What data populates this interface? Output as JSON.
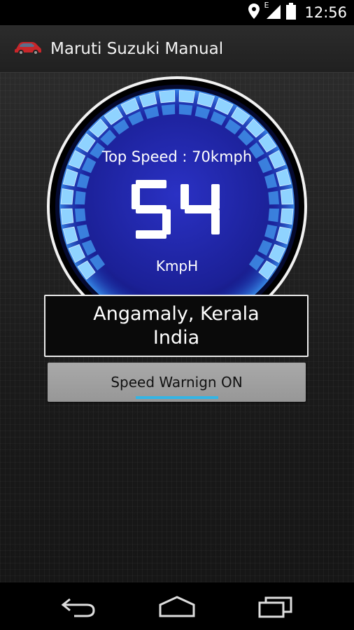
{
  "status_bar": {
    "time": "12:56",
    "network_type": "E",
    "icons": [
      "location-icon",
      "signal-icon",
      "battery-icon"
    ]
  },
  "action_bar": {
    "title": "Maruti Suzuki Manual",
    "icon": "car-icon"
  },
  "speedometer": {
    "top_speed_label": "Top Speed : 70kmph",
    "speed": "54",
    "unit": "KmpH",
    "colors": {
      "face": "#1a1f9e",
      "segments": "#7ec8ff",
      "ring": "#ffffff"
    }
  },
  "location": {
    "line1": "Angamaly, Kerala",
    "line2": "India"
  },
  "speed_warning": {
    "label": "Speed Warnign ON",
    "state": "on",
    "indicator_color": "#33b5e5"
  },
  "nav_bar": {
    "icons": [
      "back-icon",
      "home-icon",
      "recents-icon"
    ]
  }
}
